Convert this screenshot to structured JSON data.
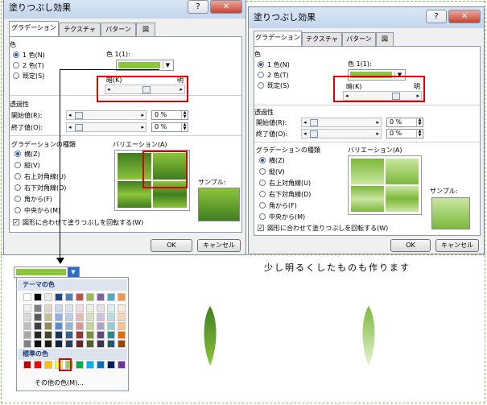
{
  "left_dialog": {
    "title": "塗りつぶし効果",
    "tabs": [
      "グラデーション",
      "テクスチャ",
      "パターン",
      "図"
    ],
    "color_section": "色",
    "radios": [
      "1 色(N)",
      "2 色(T)",
      "既定(S)"
    ],
    "color1_label": "色 1(1):",
    "dark_label": "暗(K)",
    "light_label": "明",
    "transparency_section": "透過性",
    "start_label": "開始値(R):",
    "end_label": "終了値(O):",
    "start_value": "0 %",
    "end_value": "0 %",
    "gradient_type_section": "グラデーションの種類",
    "gradient_types": [
      "横(Z)",
      "縦(V)",
      "右上対角線(U)",
      "右下対角線(D)",
      "角から(F)",
      "中央から(M)"
    ],
    "variation_label": "バリエーション(A)",
    "sample_label": "サンプル:",
    "rotate_checkbox": "図形に合わせて塗りつぶしを回転する(W)",
    "ok": "OK",
    "cancel": "キャンセル"
  },
  "right_dialog": {
    "title": "塗りつぶし効果",
    "tabs": [
      "グラデーション",
      "テクスチャ",
      "パターン",
      "図"
    ],
    "color_section": "色",
    "radios": [
      "1 色(N)",
      "2 色(T)",
      "既定(S)"
    ],
    "color1_label": "色 1(1):",
    "dark_label": "暗(K)",
    "light_label": "明",
    "transparency_section": "透過性",
    "start_label": "開始値(R):",
    "end_label": "終了値(O):",
    "start_value": "0 %",
    "end_value": "0 %",
    "gradient_type_section": "グラデーションの種類",
    "gradient_types": [
      "横(Z)",
      "縦(V)",
      "右上対角線(U)",
      "右下対角線(D)",
      "角から(F)",
      "中央から(M)"
    ],
    "variation_label": "バリエーション(A)",
    "sample_label": "サンプル:",
    "rotate_checkbox": "図形に合わせて塗りつぶしを回転する(W)",
    "ok": "OK",
    "cancel": "キャンセル"
  },
  "palette": {
    "theme_header": "テーマの色",
    "standard_header": "標準の色",
    "more_colors": "その他の色(M)...",
    "selected_color": "#9bbb59"
  },
  "note": "少し明るくしたものも作ります",
  "colors": {
    "accent_green": "#8cc43c",
    "highlight_red": "#e00000",
    "frame_green": "#8fbf5a"
  }
}
